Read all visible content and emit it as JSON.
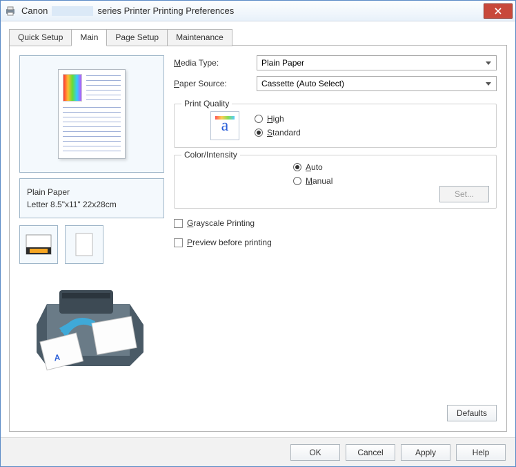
{
  "window": {
    "title_prefix": "Canon",
    "title_suffix": "series Printer Printing Preferences"
  },
  "tabs": [
    "Quick Setup",
    "Main",
    "Page Setup",
    "Maintenance"
  ],
  "active_tab": 1,
  "preview": {
    "media_type": "Plain Paper",
    "paper_size": "Letter 8.5\"x11\" 22x28cm"
  },
  "form": {
    "media_type_label": "Media Type:",
    "media_type_value": "Plain Paper",
    "paper_source_label": "Paper Source:",
    "paper_source_value": "Cassette (Auto Select)"
  },
  "print_quality": {
    "group_label": "Print Quality",
    "options": {
      "high": "High",
      "standard": "Standard"
    },
    "selected": "standard",
    "icon_letter": "a"
  },
  "color_intensity": {
    "group_label": "Color/Intensity",
    "options": {
      "auto": "Auto",
      "manual": "Manual"
    },
    "selected": "auto",
    "set_button": "Set..."
  },
  "checkboxes": {
    "grayscale": "Grayscale Printing",
    "preview": "Preview before printing"
  },
  "buttons": {
    "defaults": "Defaults",
    "ok": "OK",
    "cancel": "Cancel",
    "apply": "Apply",
    "help": "Help"
  }
}
